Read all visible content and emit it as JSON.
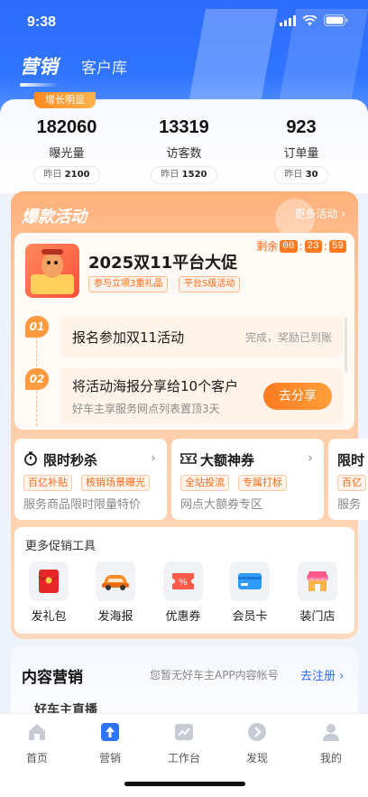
{
  "status_bar": {
    "time": "9:38"
  },
  "header": {
    "tabs": [
      {
        "label": "营销",
        "active": true
      },
      {
        "label": "客户库",
        "active": false
      }
    ]
  },
  "stats": {
    "badge": "增长明显",
    "items": [
      {
        "value": "182060",
        "label": "曝光量",
        "yesterday_prefix": "昨日",
        "yesterday_value": "2100"
      },
      {
        "value": "13319",
        "label": "访客数",
        "yesterday_prefix": "昨日",
        "yesterday_value": "1520"
      },
      {
        "value": "923",
        "label": "订单量",
        "yesterday_prefix": "昨日",
        "yesterday_value": "30"
      }
    ]
  },
  "promo": {
    "title": "爆款活动",
    "more": "更多活动 ›",
    "activity": {
      "title": "2025双11平台大促",
      "tags": [
        "参与立项3重礼品",
        "平台S级活动"
      ],
      "countdown_label": "剩余",
      "countdown": [
        "00",
        "23",
        "59"
      ]
    },
    "steps": [
      {
        "no": "01",
        "title": "报名参加双11活动",
        "hint": "完成，奖励已到账"
      },
      {
        "no": "02",
        "title": "将活动海报分享给10个客户",
        "sub": "好车主享服务网点列表置顶3天",
        "button": "去分享"
      }
    ],
    "mini_cards": [
      {
        "title": "限时秒杀",
        "tags": [
          "百亿补贴",
          "核销场景曝光"
        ],
        "desc": "服务商品限时限量特价"
      },
      {
        "title": "大额神券",
        "tags": [
          "全站投流",
          "专属打标"
        ],
        "desc": "网点大额券专区"
      },
      {
        "title": "限时",
        "tags": [
          "百亿"
        ],
        "desc": "服务"
      }
    ],
    "tools": {
      "title": "更多促销工具",
      "items": [
        {
          "label": "发礼包",
          "icon": "red-envelope-icon"
        },
        {
          "label": "发海报",
          "icon": "car-poster-icon"
        },
        {
          "label": "优惠券",
          "icon": "coupon-icon"
        },
        {
          "label": "会员卡",
          "icon": "member-card-icon"
        },
        {
          "label": "装门店",
          "icon": "storefront-icon"
        }
      ]
    }
  },
  "content_marketing": {
    "title": "内容营销",
    "hint": "您暂无好车主APP内容帐号",
    "link": "去注册 ›",
    "sub": "好车主直播"
  },
  "tabbar": {
    "items": [
      {
        "label": "首页",
        "icon": "home-icon",
        "active": false
      },
      {
        "label": "营销",
        "icon": "marketing-icon",
        "active": true
      },
      {
        "label": "工作台",
        "icon": "workbench-icon",
        "active": false
      },
      {
        "label": "发现",
        "icon": "discover-icon",
        "active": false
      },
      {
        "label": "我的",
        "icon": "profile-icon",
        "active": false
      }
    ]
  },
  "colors": {
    "primary_blue": "#2f74ff",
    "accent_orange": "#ff7a1f"
  }
}
